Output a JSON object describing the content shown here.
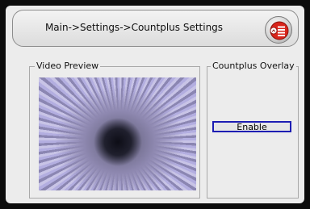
{
  "header": {
    "breadcrumb": "Main->Settings->Countplus Settings",
    "menu_icon": "menu-list-icon"
  },
  "video_preview": {
    "label": "Video Preview"
  },
  "countplus_overlay": {
    "label": "Countplus Overlay",
    "enable_label": "Enable"
  },
  "colors": {
    "panel_bg": "#ececec",
    "button_border": "#1d1db3",
    "menu_icon_red": "#d9241b"
  }
}
